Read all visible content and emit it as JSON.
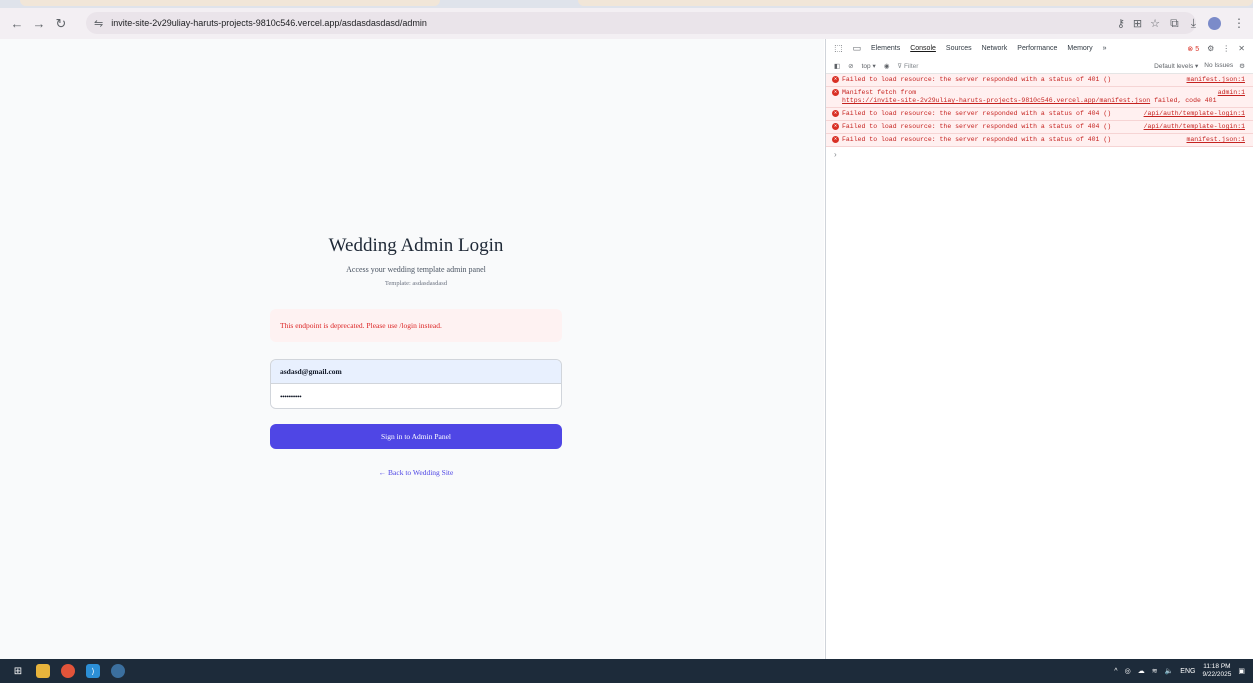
{
  "browser": {
    "url": "invite-site-2v29uliay-haruts-projects-9810c546.vercel.app/asdasdasdasd/admin"
  },
  "login": {
    "title": "Wedding Admin Login",
    "subtitle": "Access your wedding template admin panel",
    "template_label": "Template: asdasdasdasd",
    "error_message": "This endpoint is deprecated. Please use /login instead.",
    "email_value": "asdasd@gmail.com",
    "password_value": "••••••••••",
    "submit_label": "Sign in to Admin Panel",
    "back_link": "← Back to Wedding Site"
  },
  "devtools": {
    "tabs": [
      "Elements",
      "Console",
      "Sources",
      "Network",
      "Performance",
      "Memory"
    ],
    "more_tabs": "»",
    "error_count": "5",
    "context": "top ▾",
    "filter_placeholder": "Filter",
    "levels": "Default levels ▾",
    "issues": "No Issues",
    "messages": [
      {
        "text": "Failed to load resource: the server responded with a status of 401 ()",
        "source": "manifest.json:1"
      },
      {
        "text": "Manifest fetch from",
        "link": "https://invite-site-2v29uliay-haruts-projects-9810c546.vercel.app/manifest.json",
        "tail": "failed, code 401",
        "source": "admin:1"
      },
      {
        "text": "Failed to load resource: the server responded with a status of 404 ()",
        "source": "/api/auth/template-login:1"
      },
      {
        "text": "Failed to load resource: the server responded with a status of 404 ()",
        "source": "/api/auth/template-login:1"
      },
      {
        "text": "Failed to load resource: the server responded with a status of 401 ()",
        "source": "manifest.json:1"
      }
    ],
    "prompt": "›"
  },
  "taskbar": {
    "lang": "ENG",
    "time": "11:18 PM",
    "date": "9/22/2025"
  },
  "colors": {
    "accent": "#4f46e5",
    "error_text": "#dc2626",
    "error_bg": "#fef2f2",
    "taskbar": "#1d2b3a"
  }
}
